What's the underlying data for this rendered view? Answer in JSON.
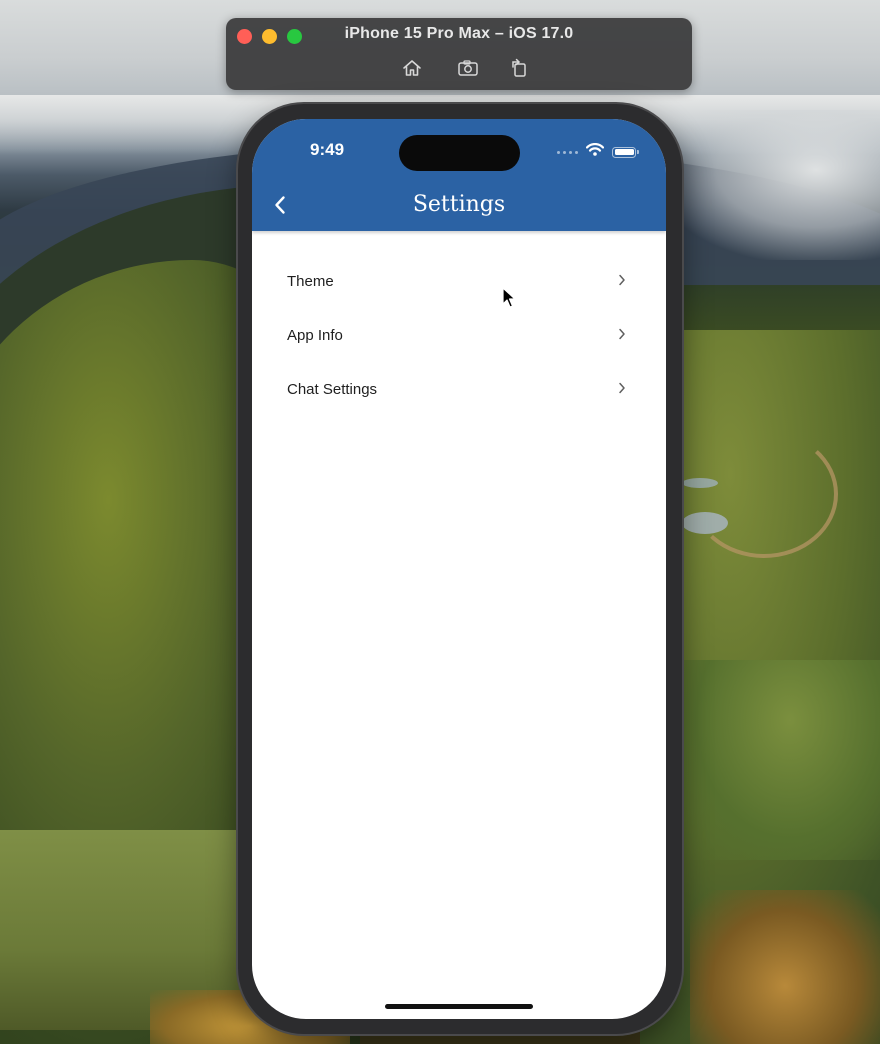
{
  "simulator": {
    "title": "iPhone 15 Pro Max – iOS 17.0",
    "tools": [
      "home-icon",
      "screenshot-icon",
      "rotate-icon"
    ]
  },
  "status_bar": {
    "time": "9:49"
  },
  "app_bar": {
    "title": "Settings",
    "color": "#2b62a4"
  },
  "settings": {
    "items": [
      {
        "label": "Theme"
      },
      {
        "label": "App Info"
      },
      {
        "label": "Chat Settings"
      }
    ]
  }
}
